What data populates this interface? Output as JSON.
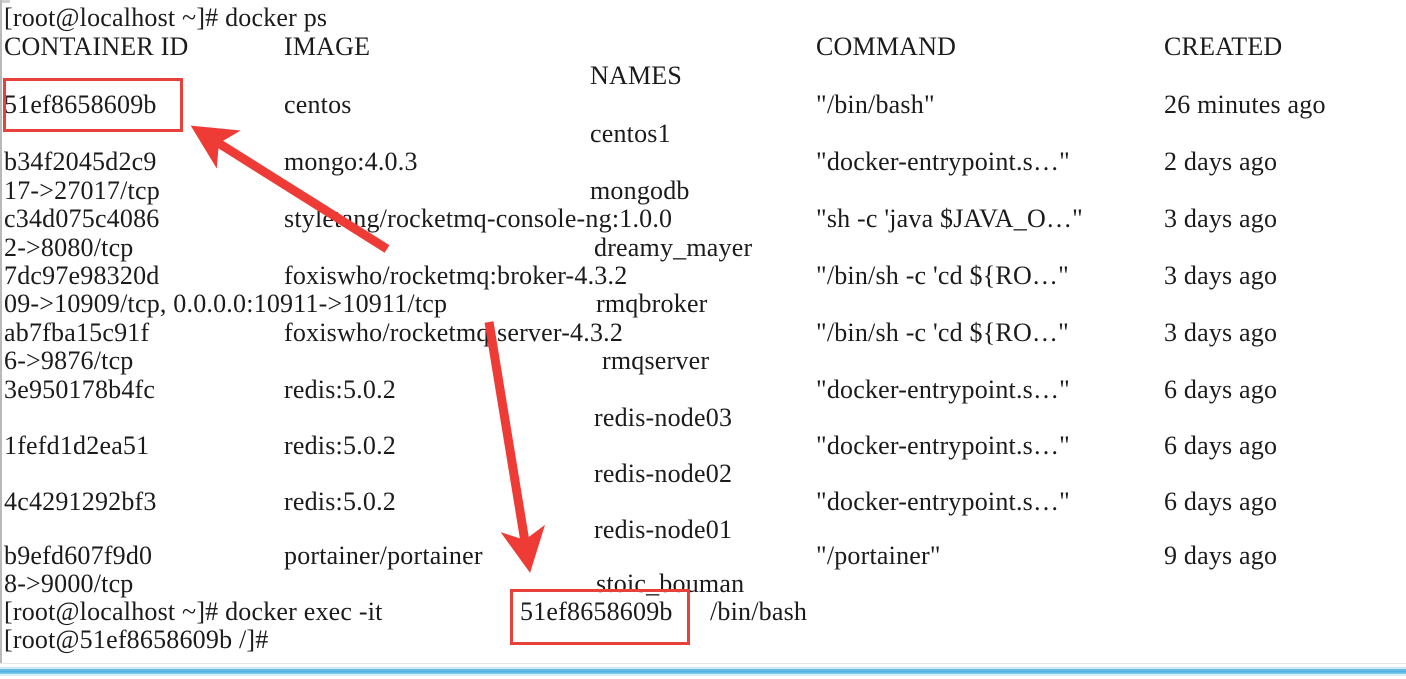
{
  "terminal": {
    "prompt_line": "[root@localhost ~]# docker ps",
    "headers": {
      "container_id": "CONTAINER ID",
      "image": "IMAGE",
      "command": "COMMAND",
      "created": "CREATED",
      "names": "NAMES"
    },
    "rows": [
      {
        "container_id": "51ef8658609b",
        "image": "centos",
        "command": "\"/bin/bash\"",
        "created": "26 minutes ago",
        "ports": "",
        "names": "centos1"
      },
      {
        "container_id": "b34f2045d2c9",
        "image": "mongo:4.0.3",
        "command": "\"docker-entrypoint.s…\"",
        "created": "2 days ago",
        "ports": "17->27017/tcp",
        "names": "mongodb"
      },
      {
        "container_id": "c34d075c4086",
        "image": "styletang/rocketmq-console-ng:1.0.0",
        "command": "\"sh -c 'java $JAVA_O…\"",
        "created": "3 days ago",
        "ports": "2->8080/tcp",
        "names": "dreamy_mayer"
      },
      {
        "container_id": "7dc97e98320d",
        "image": "foxiswho/rocketmq:broker-4.3.2",
        "command": "\"/bin/sh -c 'cd ${RO…\"",
        "created": "3 days ago",
        "ports": "09->10909/tcp, 0.0.0.0:10911->10911/tcp",
        "names": "rmqbroker"
      },
      {
        "container_id": "ab7fba15c91f",
        "image": "foxiswho/rocketmq:server-4.3.2",
        "command": "\"/bin/sh -c 'cd ${RO…\"",
        "created": "3 days ago",
        "ports": "6->9876/tcp",
        "names": "rmqserver"
      },
      {
        "container_id": "3e950178b4fc",
        "image": "redis:5.0.2",
        "command": "\"docker-entrypoint.s…\"",
        "created": "6 days ago",
        "ports": "",
        "names": "redis-node03"
      },
      {
        "container_id": "1fefd1d2ea51",
        "image": "redis:5.0.2",
        "command": "\"docker-entrypoint.s…\"",
        "created": "6 days ago",
        "ports": "",
        "names": "redis-node02"
      },
      {
        "container_id": "4c4291292bf3",
        "image": "redis:5.0.2",
        "command": "\"docker-entrypoint.s…\"",
        "created": "6 days ago",
        "ports": "",
        "names": "redis-node01"
      },
      {
        "container_id": "b9efd607f9d0",
        "image": "portainer/portainer",
        "command": "\"/portainer\"",
        "created": "9 days ago",
        "ports": "8->9000/tcp",
        "names": "stoic_bouman"
      }
    ],
    "exec_line": "[root@localhost ~]# docker exec -it",
    "exec_target": "51ef8658609b",
    "exec_tail": "/bin/bash",
    "final_prompt": "[root@51ef8658609b /]#"
  },
  "annotations": {
    "highlight_color": "#e8403a",
    "box_top_label": "51ef8658609b",
    "box_bottom_label": "51ef8658609b",
    "arrow_count": 2
  }
}
